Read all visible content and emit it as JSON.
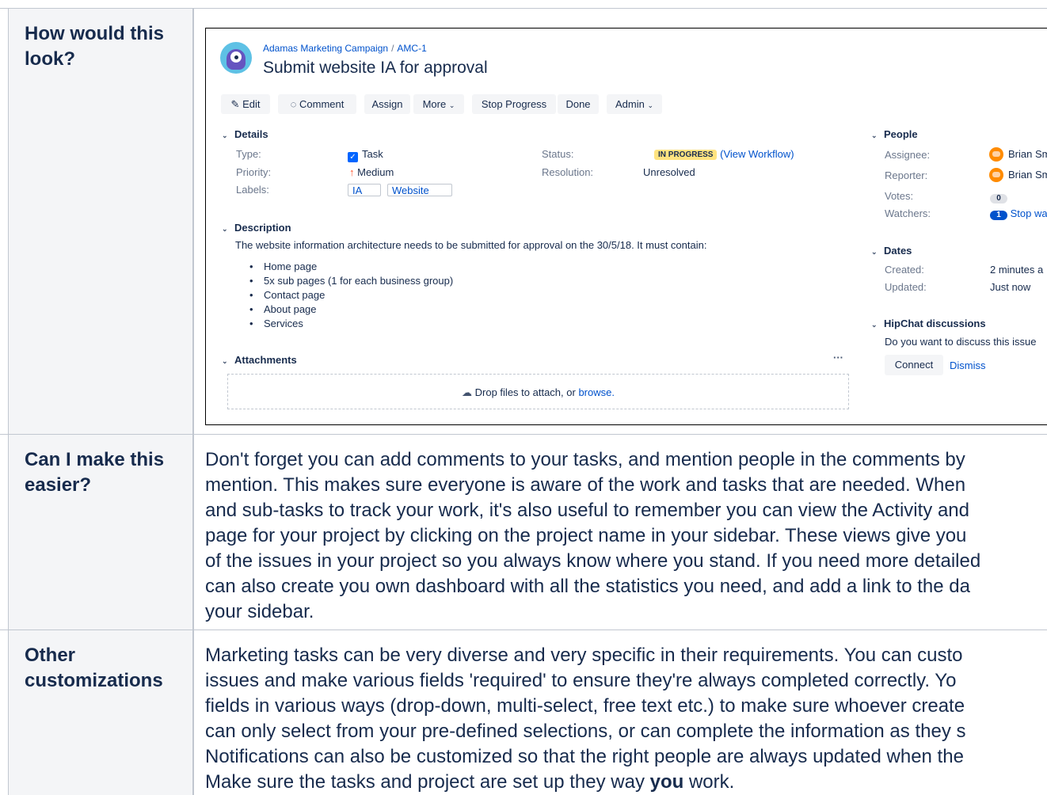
{
  "rows": [
    {
      "heading": "How would this look?"
    },
    {
      "heading": "Can I make this easier?",
      "lines": [
        "Don't forget you can add comments to your tasks, and mention people in the comments by",
        "mention. This makes sure everyone is aware of the work and tasks that are needed. When",
        "and sub-tasks to track your work, it's also useful to remember you can view the Activity and",
        "page for your project by clicking on the project name in your sidebar. These views give you",
        "of the issues in your project so you always know where you stand. If you need more detailed",
        "can also create you own dashboard with all the statistics you need, and add a link to the da",
        "your sidebar."
      ]
    },
    {
      "heading": "Other customizations",
      "lines": [
        "Marketing tasks can be very diverse and very specific in their requirements. You can custo",
        "issues and make various fields 'required' to ensure they're always completed correctly. Yo",
        "fields in various ways (drop-down, multi-select, free text etc.) to make sure whoever create",
        "can only select from your pre-defined selections, or can complete the information as they s",
        "Notifications can also be customized so that the right people are always updated when the"
      ],
      "last_line": {
        "before": "Make sure the tasks and project are set up they way ",
        "bold": "you",
        "after": " work."
      }
    }
  ],
  "issue": {
    "project": "Adamas Marketing Campaign",
    "crumb_sep": "/",
    "key": "AMC-1",
    "title": "Submit website IA for approval",
    "buttons": {
      "edit": "Edit",
      "comment": "Comment",
      "assign": "Assign",
      "more": "More",
      "stop_progress": "Stop Progress",
      "done": "Done",
      "admin": "Admin"
    },
    "details": {
      "heading": "Details",
      "type_label": "Type:",
      "type_value": "Task",
      "priority_label": "Priority:",
      "priority_value": "Medium",
      "labels_label": "Labels:",
      "labels": [
        "IA",
        "Website"
      ],
      "status_label": "Status:",
      "status_value": "IN PROGRESS",
      "view_workflow": "View Workflow",
      "resolution_label": "Resolution:",
      "resolution_value": "Unresolved"
    },
    "description": {
      "heading": "Description",
      "text": "The website information architecture needs to be submitted for approval on the 30/5/18. It must contain:",
      "items": [
        "Home page",
        "5x sub pages (1 for each business group)",
        "Contact page",
        "About page",
        "Services"
      ]
    },
    "attachments": {
      "heading": "Attachments",
      "more": "···",
      "drop_text": "Drop files to attach, or",
      "browse": "browse."
    },
    "people": {
      "heading": "People",
      "assignee_label": "Assignee:",
      "assignee": "Brian Sm",
      "reporter_label": "Reporter:",
      "reporter": "Brian Sm",
      "votes_label": "Votes:",
      "votes": "0",
      "watchers_label": "Watchers:",
      "watchers": "1",
      "stop_watching": "Stop wa"
    },
    "dates": {
      "heading": "Dates",
      "created_label": "Created:",
      "created": "2 minutes a",
      "updated_label": "Updated:",
      "updated": "Just now"
    },
    "hipchat": {
      "heading": "HipChat discussions",
      "prompt": "Do you want to discuss this issue",
      "connect": "Connect",
      "dismiss": "Dismiss"
    }
  },
  "colors": {
    "accent": "#0052cc",
    "status_lozenge": "#ffe380",
    "header_bg": "#f4f5f7"
  }
}
